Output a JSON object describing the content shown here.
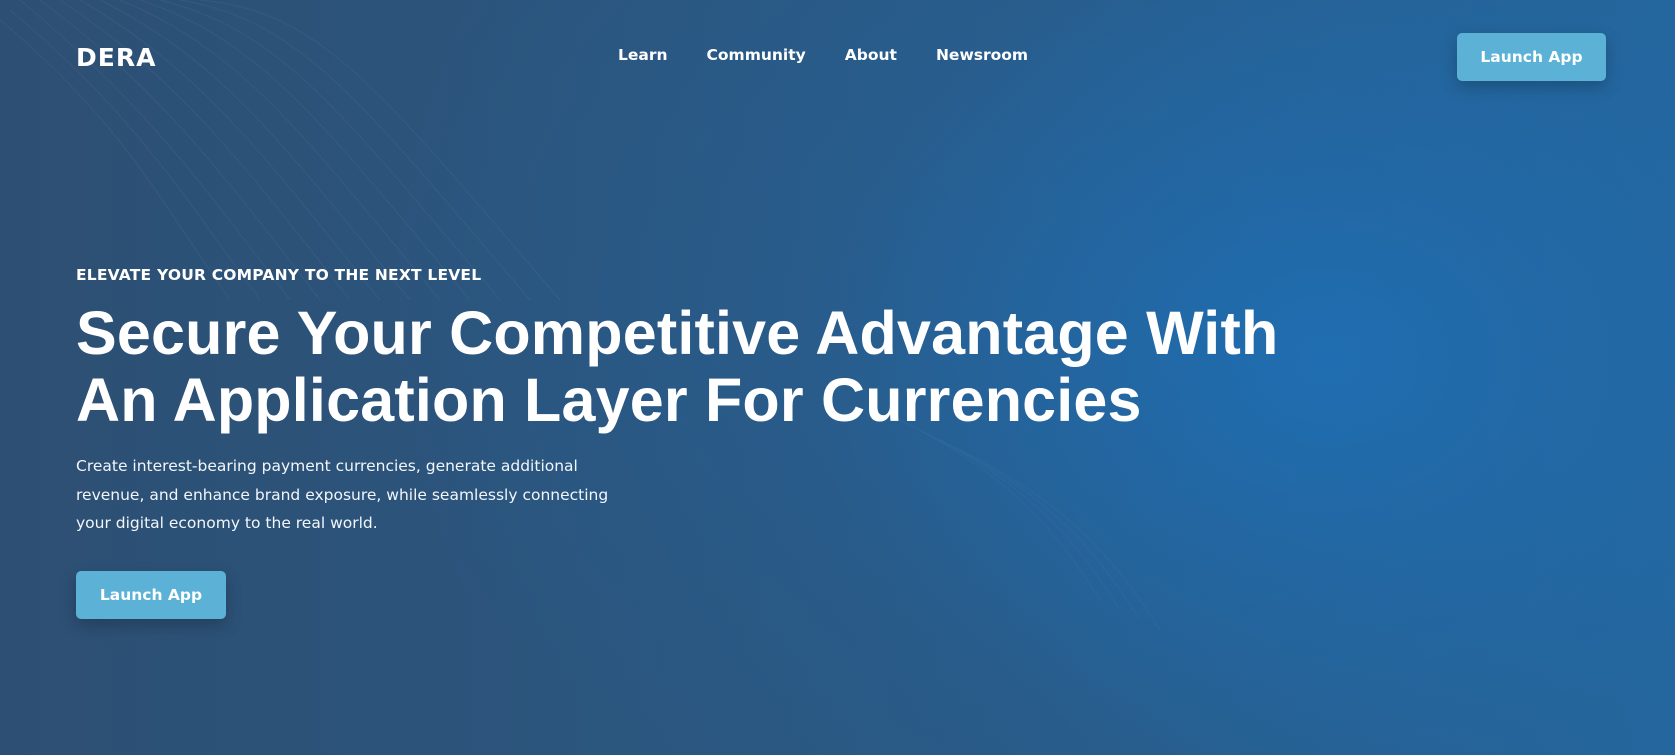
{
  "header": {
    "logo": "DERA",
    "nav": [
      "Learn",
      "Community",
      "About",
      "Newsroom"
    ],
    "cta_label": "Launch App"
  },
  "hero": {
    "eyebrow": "ELEVATE YOUR COMPANY TO THE NEXT LEVEL",
    "title_line1": "Secure Your Competitive Advantage With",
    "title_line2": "An Application Layer For Currencies",
    "description": "Create interest-bearing payment currencies, generate additional revenue, and enhance brand exposure, while seamlessly connecting your digital economy to the real world.",
    "cta_label": "Launch App"
  },
  "colors": {
    "background": "#2c5277",
    "accent_button": "#5bb2d6",
    "text": "#ffffff"
  }
}
